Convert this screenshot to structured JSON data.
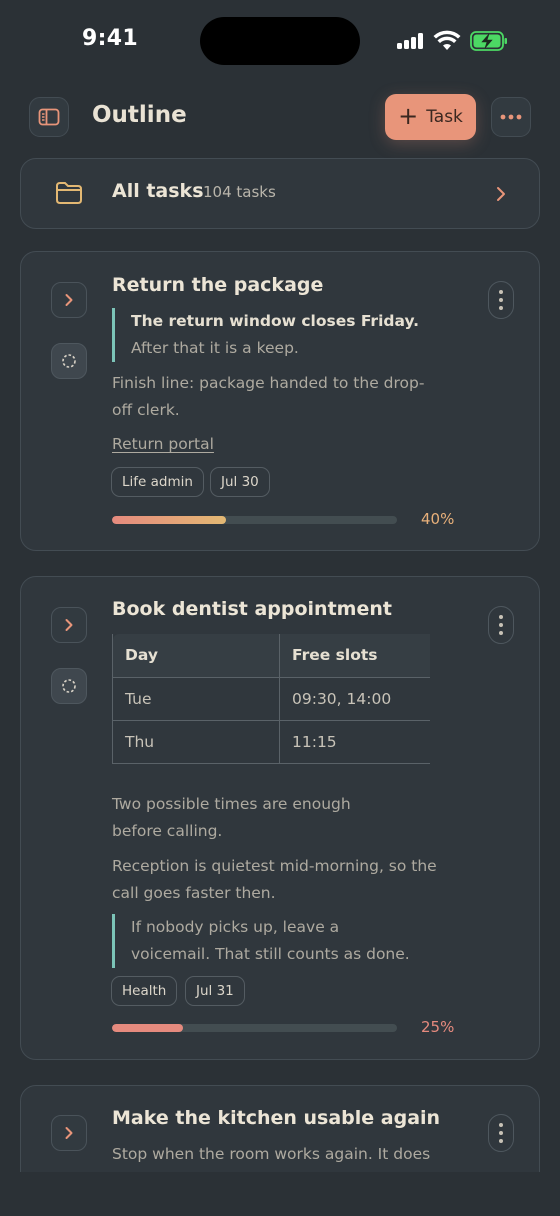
{
  "status_bar": {
    "time": "9:41"
  },
  "header": {
    "title": "Outline",
    "add_task_label": "Task"
  },
  "all_tasks": {
    "name": "All tasks",
    "count": "104 tasks"
  },
  "tasks": [
    {
      "title": "Return the package",
      "quote_bold": "The return window closes Friday.",
      "quote_rest": " After that it is a keep.",
      "para": "Finish line: package handed to the drop-off clerk.",
      "link": "Return portal",
      "tags": [
        "Life admin",
        "Jul 30"
      ],
      "progress": 0.4,
      "progress_label": "40%",
      "color": "#e8b07a"
    },
    {
      "title": "Book dentist appointment",
      "table": {
        "headers": [
          "Day",
          "Free slots"
        ],
        "rows": [
          [
            "Tue",
            "09:30, 14:00"
          ],
          [
            "Thu",
            "11:15"
          ]
        ]
      },
      "para1": "Two possible times are enough before calling.",
      "para2": "Reception is quietest mid-morning, so the call goes faster then.",
      "quote": "If nobody picks up, leave a voicemail. That still counts as done.",
      "tags": [
        "Health",
        "Jul 31"
      ],
      "progress": 0.25,
      "progress_label": "25%",
      "color": "#e58a7e"
    },
    {
      "title": "Make the kitchen usable again",
      "para": "Stop when the room works again. It does"
    }
  ]
}
